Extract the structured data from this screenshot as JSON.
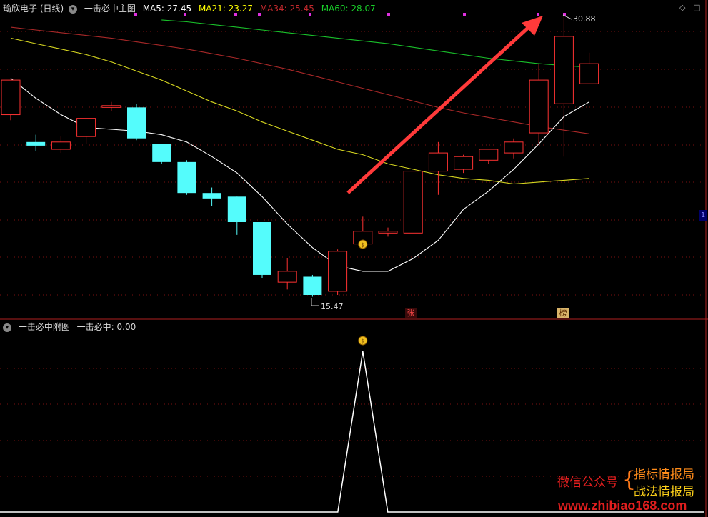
{
  "main_panel": {
    "stock_name": "瑜欣电子 (日线)",
    "indicator_name": "一击必中主图",
    "ma": [
      {
        "label": "MA5: 27.45",
        "color": "#ffffff"
      },
      {
        "label": "MA21: 23.27",
        "color": "#ffff00"
      },
      {
        "label": "MA34: 25.45",
        "color": "#c0282c"
      },
      {
        "label": "MA60: 28.07",
        "color": "#19d02a"
      }
    ],
    "high_label": "30.88",
    "low_label": "15.47",
    "tag_zhang": "张",
    "tag_bang": "榜",
    "right_marker": "1",
    "corner_icons": [
      "◇",
      "□"
    ]
  },
  "sub_panel": {
    "indicator_name": "一击必中附图",
    "value_label": "一击必中: 0.00"
  },
  "watermark": {
    "wechat": "微信公众号",
    "line1": "指标情报局",
    "line2": "战法情报局",
    "url": "www.zhibiao168.com"
  },
  "chart_data": {
    "type": "candlestick",
    "candles": [
      {
        "o": 25.5,
        "c": 27.4,
        "h": 27.4,
        "l": 25.2
      },
      {
        "o": 24.0,
        "c": 23.8,
        "h": 24.4,
        "l": 23.5
      },
      {
        "o": 23.6,
        "c": 24.0,
        "h": 24.3,
        "l": 23.4
      },
      {
        "o": 24.3,
        "c": 25.3,
        "h": 25.3,
        "l": 23.9
      },
      {
        "o": 25.9,
        "c": 26.0,
        "h": 26.2,
        "l": 25.7
      },
      {
        "o": 25.9,
        "c": 24.2,
        "h": 26.1,
        "l": 24.1
      },
      {
        "o": 23.9,
        "c": 22.9,
        "h": 23.9,
        "l": 22.8
      },
      {
        "o": 22.9,
        "c": 21.2,
        "h": 23.0,
        "l": 21.1
      },
      {
        "o": 21.2,
        "c": 20.9,
        "h": 21.5,
        "l": 20.5
      },
      {
        "o": 21.0,
        "c": 19.6,
        "h": 21.0,
        "l": 18.9
      },
      {
        "o": 19.6,
        "c": 16.7,
        "h": 19.6,
        "l": 16.5
      },
      {
        "o": 16.3,
        "c": 16.9,
        "h": 17.6,
        "l": 15.9
      },
      {
        "o": 16.6,
        "c": 15.6,
        "h": 16.7,
        "l": 15.5
      },
      {
        "o": 15.8,
        "c": 18.0,
        "h": 18.1,
        "l": 15.6
      },
      {
        "o": 18.4,
        "c": 19.1,
        "h": 19.9,
        "l": 18.4
      },
      {
        "o": 19.0,
        "c": 19.1,
        "h": 19.3,
        "l": 18.8
      },
      {
        "o": 19.0,
        "c": 22.4,
        "h": 22.4,
        "l": 19.0
      },
      {
        "o": 22.4,
        "c": 23.4,
        "h": 24.0,
        "l": 21.1
      },
      {
        "o": 22.5,
        "c": 23.2,
        "h": 23.3,
        "l": 22.3
      },
      {
        "o": 23.0,
        "c": 23.6,
        "h": 23.6,
        "l": 22.8
      },
      {
        "o": 23.4,
        "c": 24.0,
        "h": 24.2,
        "l": 23.1
      },
      {
        "o": 24.5,
        "c": 27.4,
        "h": 28.3,
        "l": 23.9
      },
      {
        "o": 26.1,
        "c": 29.8,
        "h": 30.9,
        "l": 23.2
      },
      {
        "o": 27.2,
        "c": 28.3,
        "h": 28.9,
        "l": 27.2
      }
    ],
    "ma5": [
      27.5,
      26.4,
      25.5,
      24.8,
      24.7,
      24.6,
      24.4,
      24.0,
      23.2,
      22.3,
      21.0,
      19.5,
      18.2,
      17.2,
      16.9,
      16.9,
      17.6,
      18.6,
      20.3,
      21.3,
      22.5,
      23.9,
      25.4,
      26.2
    ],
    "ma21": [
      29.7,
      29.4,
      29.1,
      28.8,
      28.4,
      27.9,
      27.4,
      26.8,
      26.2,
      25.7,
      25.1,
      24.6,
      24.1,
      23.6,
      23.3,
      22.8,
      22.5,
      22.2,
      22.0,
      21.9,
      21.7,
      21.8,
      21.9,
      22.0
    ],
    "ma34": [
      30.3,
      30.15,
      30.0,
      29.85,
      29.7,
      29.5,
      29.3,
      29.1,
      28.85,
      28.6,
      28.3,
      28.0,
      27.65,
      27.3,
      26.95,
      26.6,
      26.25,
      25.9,
      25.6,
      25.35,
      25.1,
      24.85,
      24.65,
      24.45
    ],
    "ma60": [
      30.7,
      30.6,
      30.45,
      30.3,
      30.15,
      30.0,
      29.85,
      29.7,
      29.55,
      29.4,
      29.2,
      29.0,
      28.8,
      28.6,
      28.45,
      28.3,
      28.2,
      28.1
    ],
    "signal": {
      "index": 14,
      "value": 1.0
    },
    "price_high": 30.88,
    "price_low": 15.47
  }
}
